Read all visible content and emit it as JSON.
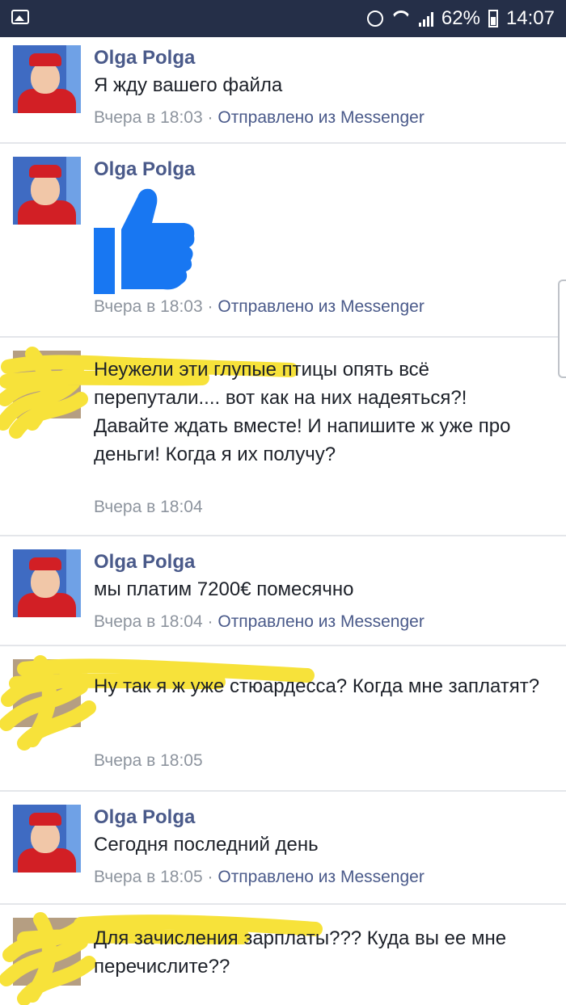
{
  "status_bar": {
    "battery_percent": "62%",
    "time": "14:07",
    "icons": [
      "image-icon",
      "alarm-icon",
      "wifi-icon",
      "signal-icon",
      "battery-icon"
    ]
  },
  "messages": [
    {
      "author": "Olga Polga",
      "text": "Я жду вашего файла",
      "time": "Вчера в 18:03",
      "separator": "·",
      "via": "Отправлено из Messenger"
    },
    {
      "author": "Olga Polga",
      "text": "",
      "sticker": "thumbs-up",
      "time": "Вчера в 18:03",
      "separator": "·",
      "via": "Отправлено из Messenger"
    },
    {
      "author": "",
      "redacted": true,
      "text": "Неужели эти глупые птицы опять всё перепутали.... вот как на них надеяться?! Давайте ждать вместе! И напишите ж уже про деньги! Когда я их получу?",
      "time": "Вчера в 18:04"
    },
    {
      "author": "Olga Polga",
      "text": "мы платим 7200€ помесячно",
      "time": "Вчера в 18:04",
      "separator": "·",
      "via": "Отправлено из Messenger"
    },
    {
      "author": "",
      "redacted": true,
      "text": "Ну так я ж уже стюардесса? Когда мне заплатят?",
      "time": "Вчера в 18:05"
    },
    {
      "author": "Olga Polga",
      "text": "Сегодня последний день",
      "time": "Вчера в 18:05",
      "separator": "·",
      "via": "Отправлено из Messenger"
    },
    {
      "author": "",
      "redacted": true,
      "text": "Для зачисления зарплаты??? Куда вы ее мне перечислите??",
      "time": ""
    }
  ],
  "colors": {
    "status_bar": "#252f48",
    "name": "#4a5a8a",
    "meta": "#8d949e",
    "thumb": "#1877f2",
    "highlight": "#f7e23a"
  }
}
